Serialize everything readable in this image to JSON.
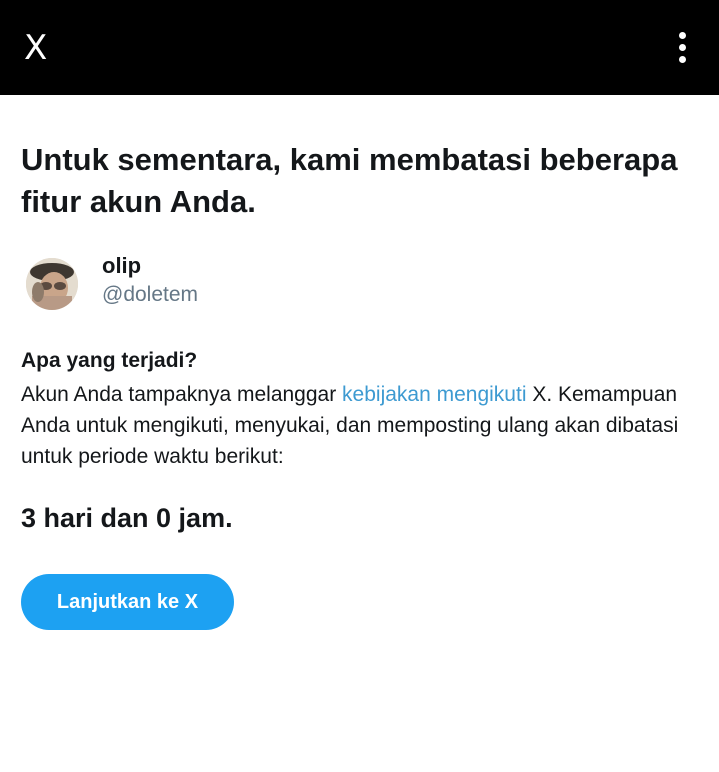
{
  "header": {
    "close_label": "X",
    "menu_icon": "vertical-ellipsis-icon"
  },
  "title": "Untuk sementara, kami membatasi beberapa fitur akun Anda.",
  "user": {
    "name": "olip",
    "handle": "@doletem",
    "avatar": "user-avatar-photo"
  },
  "section": {
    "heading": "Apa yang terjadi?",
    "text_before_link": "Akun Anda tampaknya melanggar ",
    "link_text": "kebijakan mengikuti",
    "text_after_link": " X. Kemampuan Anda untuk mengikuti, menyukai, dan memposting ulang akan dibatasi untuk periode waktu berikut:"
  },
  "duration": "3 hari dan 0 jam.",
  "continue_button": "Lanjutkan ke X",
  "colors": {
    "header_bg": "#000000",
    "link": "#3d9ad1",
    "button": "#1da1f2",
    "handle": "#657786"
  }
}
